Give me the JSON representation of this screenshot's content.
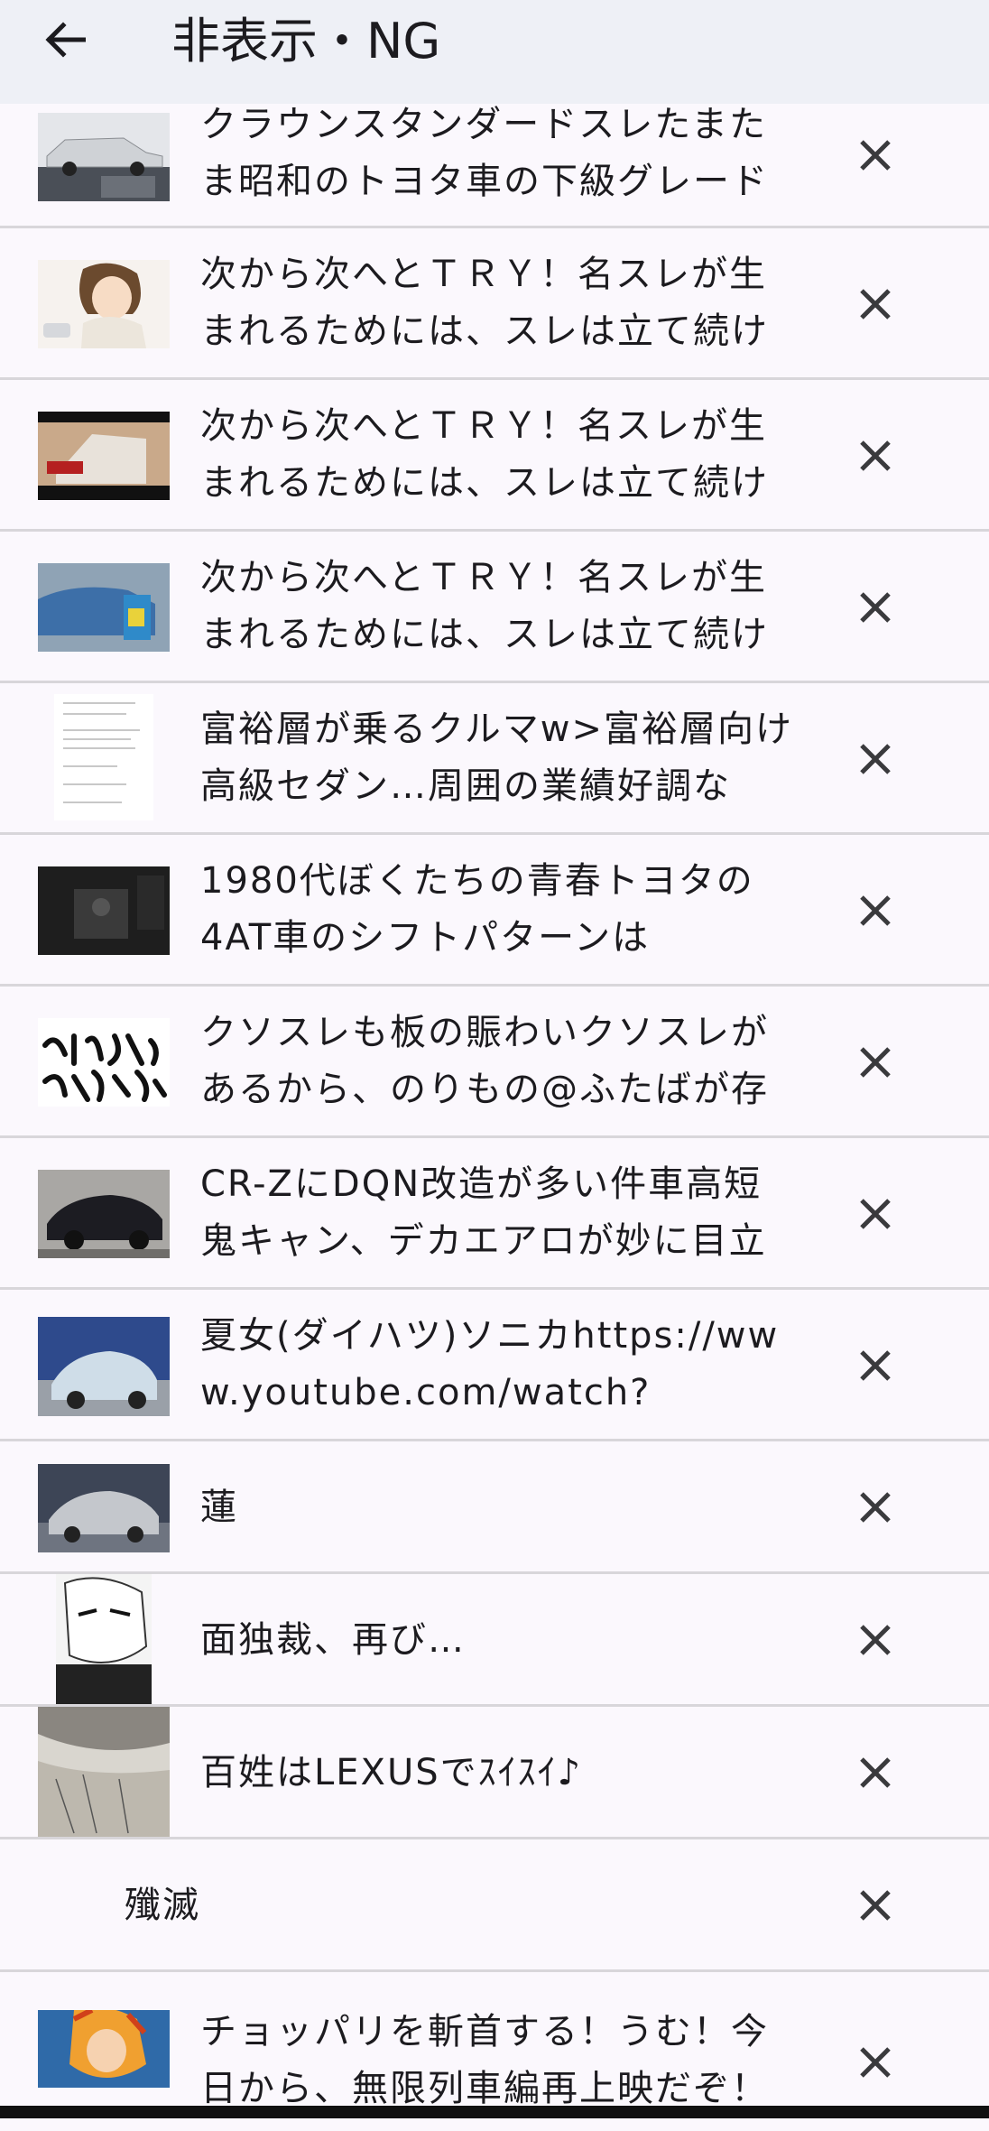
{
  "appbar": {
    "title": "非表示・NG",
    "back_icon": "arrow-left-icon"
  },
  "items": [
    {
      "text": "クラウンスタンダードスレたまたま昭和のトヨタ車の下級グレード",
      "thumb": "silver-sedan-photo"
    },
    {
      "text": "次から次へとＴＲＹ！名スレが生まれるためには、スレは立て続け",
      "thumb": "anime-girl-illustration"
    },
    {
      "text": "次から次へとＴＲＹ！名スレが生まれるためには、スレは立て続け",
      "thumb": "building-photo"
    },
    {
      "text": "次から次へとＴＲＹ！名スレが生まれるためには、スレは立て続け",
      "thumb": "blue-car-photo"
    },
    {
      "text": "富裕層が乗るクルマw>富裕層向け高級セダン…周囲の業績好調な",
      "thumb": "document-image"
    },
    {
      "text": "1980代ぼくたちの青春トヨタの4AT車のシフトパターンは",
      "thumb": "car-interior-photo"
    },
    {
      "text": "クソスレも板の賑わいクソスレがあるから、のりもの@ふたばが存",
      "thumb": "calligraphy-image"
    },
    {
      "text": "CR-ZにDQN改造が多い件車高短鬼キャン、デカエアロが妙に目立",
      "thumb": "dark-coupe-photo"
    },
    {
      "text": "夏女(ダイハツ)ソニカhttps://www.youtube.com/watch?",
      "thumb": "light-blue-car-photo"
    },
    {
      "text": "蓮",
      "thumb": "silver-car-photo"
    },
    {
      "text": "面独裁、再び…",
      "thumb": "manga-face-image"
    },
    {
      "text": "百姓はLEXUSでｽｲｽｲ♪",
      "thumb": "manga-panel-image"
    },
    {
      "text": "殲滅",
      "thumb": ""
    },
    {
      "text": "チョッパリを斬首する！うむ！今日から、無限列車編再上映だぞ！",
      "thumb": "anime-character-image"
    }
  ],
  "close_icon": "close-icon",
  "colors": {
    "appbar": "#eef0f6",
    "background": "#fbf8fd",
    "divider": "#d8d6da"
  }
}
